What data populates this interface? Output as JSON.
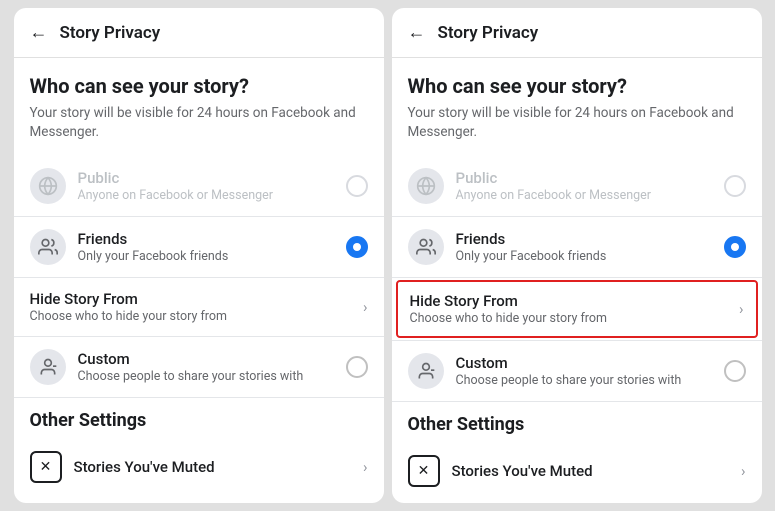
{
  "panels": [
    {
      "id": "panel-left",
      "header": {
        "back_label": "←",
        "title": "Story Privacy"
      },
      "section": {
        "heading": "Who can see your story?",
        "description": "Your story will be visible for 24 hours on Facebook and Messenger."
      },
      "options": [
        {
          "id": "public",
          "label": "Public",
          "sublabel": "Anyone on Facebook or Messenger",
          "type": "radio",
          "selected": false,
          "disabled": true
        },
        {
          "id": "friends",
          "label": "Friends",
          "sublabel": "Only your Facebook friends",
          "type": "radio",
          "selected": true,
          "disabled": false
        },
        {
          "id": "hide-story",
          "label": "Hide Story From",
          "sublabel": "Choose who to hide your story from",
          "type": "chevron",
          "highlighted": false
        },
        {
          "id": "custom",
          "label": "Custom",
          "sublabel": "Choose people to share your stories with",
          "type": "radio",
          "selected": false,
          "disabled": false
        }
      ],
      "other_settings": {
        "heading": "Other Settings",
        "items": [
          {
            "id": "muted",
            "label": "Stories You've Muted",
            "type": "chevron"
          }
        ]
      }
    },
    {
      "id": "panel-right",
      "header": {
        "back_label": "←",
        "title": "Story Privacy"
      },
      "section": {
        "heading": "Who can see your story?",
        "description": "Your story will be visible for 24 hours on Facebook and Messenger."
      },
      "options": [
        {
          "id": "public",
          "label": "Public",
          "sublabel": "Anyone on Facebook or Messenger",
          "type": "radio",
          "selected": false,
          "disabled": true
        },
        {
          "id": "friends",
          "label": "Friends",
          "sublabel": "Only your Facebook friends",
          "type": "radio",
          "selected": true,
          "disabled": false
        },
        {
          "id": "hide-story",
          "label": "Hide Story From",
          "sublabel": "Choose who to hide your story from",
          "type": "chevron",
          "highlighted": true
        },
        {
          "id": "custom",
          "label": "Custom",
          "sublabel": "Choose people to share your stories with",
          "type": "radio",
          "selected": false,
          "disabled": false
        }
      ],
      "other_settings": {
        "heading": "Other Settings",
        "items": [
          {
            "id": "muted",
            "label": "Stories You've Muted",
            "type": "chevron"
          }
        ]
      }
    }
  ],
  "icons": {
    "back": "←",
    "chevron": "›",
    "globe": "🌐",
    "friends": "👥",
    "custom": "👤",
    "muted": "✕"
  }
}
